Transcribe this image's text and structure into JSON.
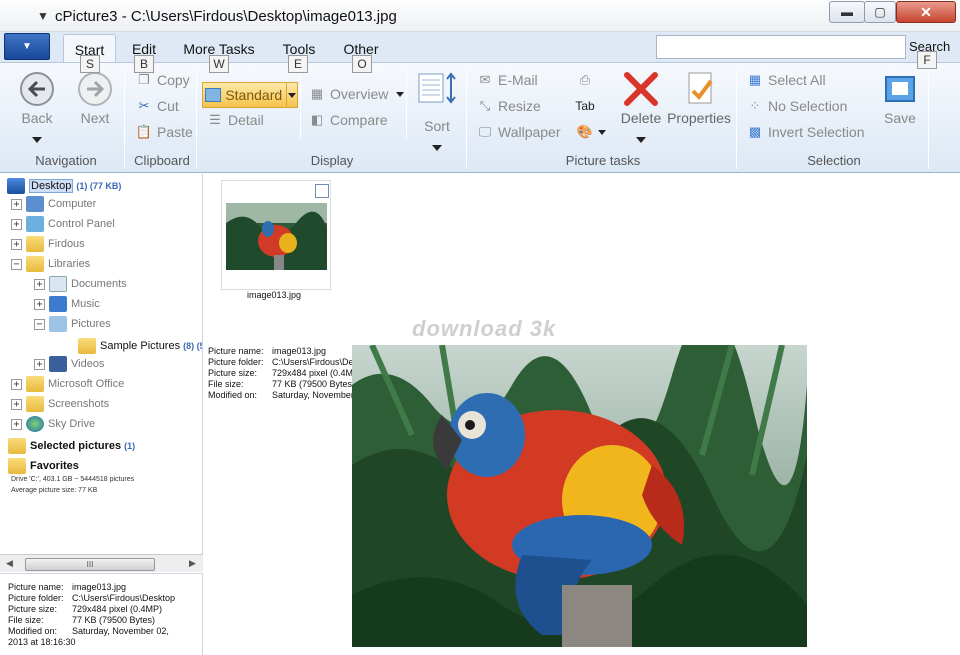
{
  "window": {
    "title": "cPicture3 - C:\\Users\\Firdous\\Desktop\\image013.jpg",
    "app_icon": "▼",
    "min_glyph": "▬",
    "max_glyph": "▢",
    "close_glyph": "✕"
  },
  "tabs": [
    {
      "label": "Start",
      "key": "S"
    },
    {
      "label": "Edit",
      "key": "B"
    },
    {
      "label": "More Tasks",
      "key": "W"
    },
    {
      "label": "Tools",
      "key": "E"
    },
    {
      "label": "Other",
      "key": "O"
    }
  ],
  "search": {
    "label": "Search",
    "key": "F",
    "value": ""
  },
  "ribbon": {
    "navigation": {
      "label": "Navigation",
      "back": "Back",
      "next": "Next"
    },
    "clipboard": {
      "label": "Clipboard",
      "copy": "Copy",
      "cut": "Cut",
      "paste": "Paste"
    },
    "display": {
      "label": "Display",
      "standard": "Standard",
      "detail": "Detail",
      "overview": "Overview",
      "compare": "Compare",
      "sort": "Sort"
    },
    "picture_tasks": {
      "label": "Picture tasks",
      "email": "E-Mail",
      "resize": "Resize",
      "wallpaper": "Wallpaper",
      "delete": "Delete",
      "properties": "Properties"
    },
    "selection": {
      "label": "Selection",
      "select_all": "Select All",
      "no_selection": "No Selection",
      "invert_selection": "Invert Selection"
    },
    "save": "Save"
  },
  "tree": {
    "desktop": {
      "label": "Desktop",
      "count": "(1) (77 KB)"
    },
    "items": [
      {
        "label": "Computer"
      },
      {
        "label": "Control Panel"
      },
      {
        "label": "Firdous"
      },
      {
        "label": "Libraries"
      },
      {
        "label": "Documents"
      },
      {
        "label": "Music"
      },
      {
        "label": "Pictures"
      },
      {
        "label": "Sample Pictures",
        "count": "(8) (5"
      },
      {
        "label": "Videos"
      },
      {
        "label": "Microsoft Office"
      },
      {
        "label": "Screenshots"
      },
      {
        "label": "Sky Drive"
      }
    ],
    "selected_pictures": {
      "label": "Selected pictures",
      "count": "(1)"
    },
    "favorites": "Favorites",
    "drive_info": "Drive 'C:', 403.1 GB ~ 5444518 pictures",
    "avg_info": "Average picture size: 77 KB"
  },
  "scrollbar": {
    "left": "◀",
    "right": "▶",
    "grip": "III"
  },
  "info": {
    "name_label": "Picture name:",
    "name": "image013.jpg",
    "folder_label": "Picture folder:",
    "folder": "C:\\Users\\Firdous\\Desktop",
    "size_label": "Picture size:",
    "size": "729x484 pixel (0.4MP)",
    "file_label": "File size:",
    "file": "77 KB (79500 Bytes)",
    "modified_label": "Modified on:",
    "modified": "Saturday, November 02, 2013 at 18:16:30",
    "modified_a": "Saturday, November 02,",
    "modified_b": "2013 at 18:16:30"
  },
  "thumbnail": {
    "filename": "image013.jpg"
  },
  "watermark": "download 3k"
}
